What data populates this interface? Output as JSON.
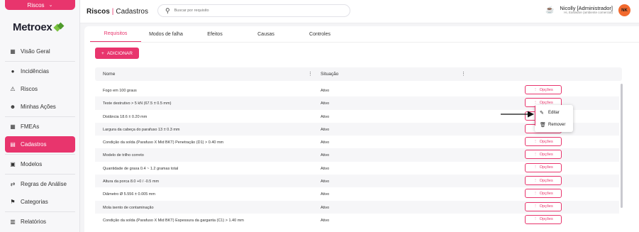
{
  "sidebar": {
    "module": "Riscos",
    "logo": "Metroex",
    "items": [
      {
        "label": "Visão Geral",
        "icon": "dashboard-icon",
        "glyph": "▦"
      },
      {
        "label": "Incidências",
        "icon": "alert-circle-icon",
        "glyph": "●"
      },
      {
        "label": "Riscos",
        "icon": "bug-icon",
        "glyph": "⚠"
      },
      {
        "label": "Minhas Ações",
        "icon": "users-icon",
        "glyph": "☻"
      },
      {
        "label": "FMEAs",
        "icon": "table-icon",
        "glyph": "▦"
      },
      {
        "label": "Cadastros",
        "icon": "form-icon",
        "glyph": "▤"
      },
      {
        "label": "Modelos",
        "icon": "template-icon",
        "glyph": "▣"
      },
      {
        "label": "Regras de Análise",
        "icon": "shuffle-icon",
        "glyph": "⇄"
      },
      {
        "label": "Categorias",
        "icon": "hierarchy-icon",
        "glyph": "⚑"
      },
      {
        "label": "Relatórios",
        "icon": "report-icon",
        "glyph": "▥"
      }
    ]
  },
  "header": {
    "title_bold": "Riscos",
    "title_sep": "|",
    "title_rest": "Cadastros",
    "search_placeholder": "Buscar por requisito",
    "user_name": "Nicolly [Administrador]",
    "user_sub": "Hi, Eastware (ambiente comercial)",
    "avatar_initials": "NK"
  },
  "tabs": [
    "Requisitos",
    "Modos de falha",
    "Efeitos",
    "Causas",
    "Controles"
  ],
  "add_button": "ADICIONAR",
  "table": {
    "columns": [
      "Nome",
      "Situação"
    ],
    "options_label": "Opções",
    "rows": [
      {
        "nome": "Fogo em 100 graus",
        "situacao": "Ativo"
      },
      {
        "nome": "Teste destrutivo > 5 kN (67.5 ± 0.5 mm)",
        "situacao": "Ativo"
      },
      {
        "nome": "Distância 18.6 ± 0.20 mm",
        "situacao": "Ativo"
      },
      {
        "nome": "Largura da cabeça do parafuso 13 ± 0.3 mm",
        "situacao": "Ativo"
      },
      {
        "nome": "Condição da solda (Parafuso X Mid BKT) Penetração (D1) > 0.40 mm",
        "situacao": "Ativo"
      },
      {
        "nome": "Modelo de trilho correto",
        "situacao": "Ativo"
      },
      {
        "nome": "Quantidade de graxa 0.4 ~ 1.2 gramas total",
        "situacao": "Ativo"
      },
      {
        "nome": "Altura da porca 8.0 +0 / -0.5 mm",
        "situacao": "Ativo"
      },
      {
        "nome": "Diâmetro Ø 5.556 ± 0.005 mm",
        "situacao": "Ativo"
      },
      {
        "nome": "Mola isento de contaminação",
        "situacao": "Ativo"
      },
      {
        "nome": "Condição da solda (Parafuso X Mid BKT) Espessura da garganta (C1) > 1.40 mm",
        "situacao": "Ativo"
      }
    ]
  },
  "context_menu": {
    "edit": "Editar",
    "remove": "Remover"
  },
  "colors": {
    "accent": "#e8356d",
    "avatar": "#f26a2e",
    "logo_green": "#7cc242"
  }
}
